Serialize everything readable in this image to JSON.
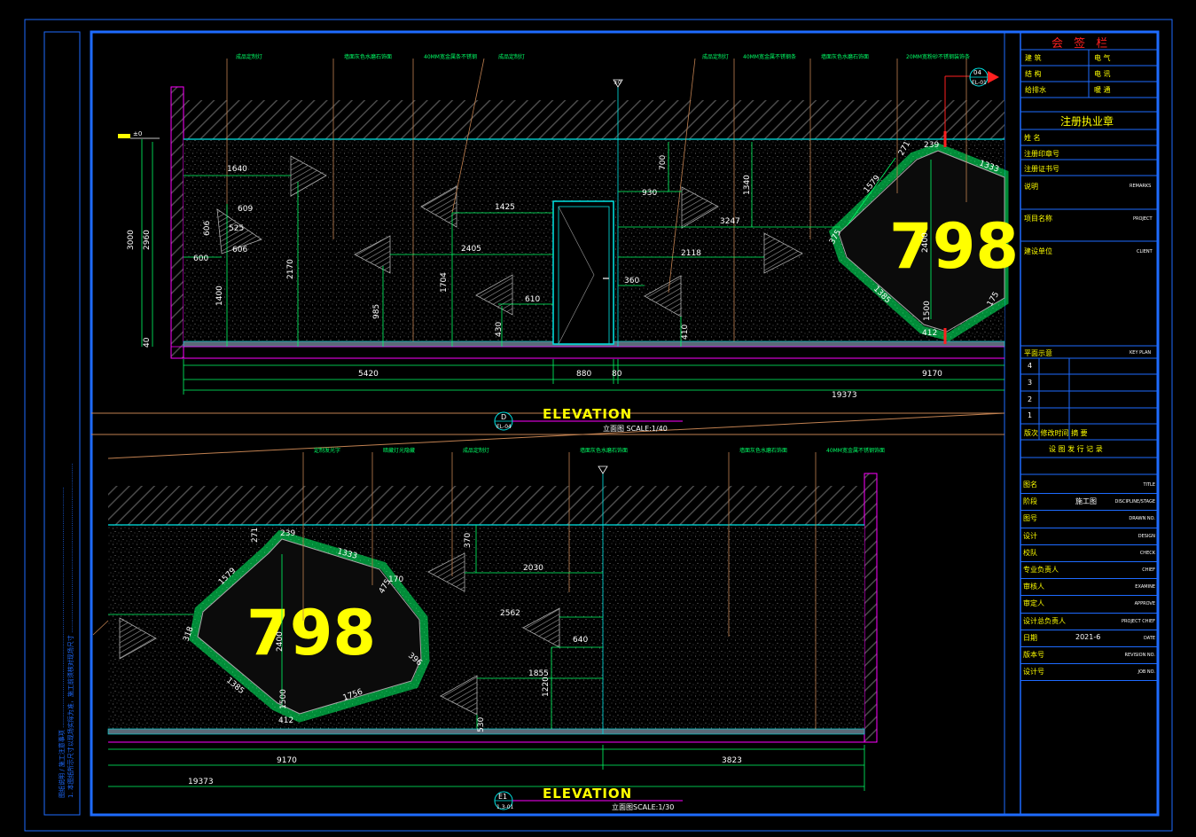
{
  "colors": {
    "frame": "#1e6bff",
    "dim": "#00ff66",
    "wall": "#ff00ff",
    "ceiling": "#00e5e5",
    "note": "#c8c800",
    "leader": "#c08050",
    "big": "#ffff00",
    "red": "#ff2020",
    "text": "#ffffff"
  },
  "top_view": {
    "big_number": "798",
    "elevation_word": "ELEVATION",
    "scale": "立面图 SCALE:1/40",
    "callout_top": "D",
    "callout_bottom": "EL-04",
    "level_mark": "±0",
    "ref_top": "04",
    "ref_bottom": "EL-01",
    "dims": {
      "d3000": "3000",
      "d2960": "2960",
      "d40": "40",
      "d1640": "1640",
      "d609": "609",
      "d525": "525",
      "d606a": "606",
      "d606b": "606",
      "d600": "600",
      "d2170": "2170",
      "d1400": "1400",
      "d985": "985",
      "d1425": "1425",
      "d2405": "2405",
      "d1704": "1704",
      "d610": "610",
      "d430": "430",
      "d700": "700",
      "d930": "930",
      "d3247": "3247",
      "d1340": "1340",
      "d2118": "2118",
      "d360": "360",
      "d410": "410",
      "d239": "239",
      "d271": "271",
      "d1333": "1333",
      "d1579": "1579",
      "d375": "375",
      "d2400": "2400",
      "d1385": "1385",
      "d1500": "1500",
      "d412": "412",
      "d175": "175",
      "d5420": "5420",
      "d880": "880",
      "d80": "80",
      "d9170": "9170",
      "d19373": "19373"
    }
  },
  "bottom_view": {
    "big_number": "798",
    "elevation_word": "ELEVATION",
    "scale": "立面图SCALE:1/30",
    "callout_top": "E1",
    "callout_bottom": "1.3-01",
    "dims": {
      "d271": "271",
      "d239": "239",
      "d1333": "1333",
      "d1579": "1579",
      "d318": "318",
      "d2400": "2400",
      "d1385": "1385",
      "d1756": "1756",
      "d1500": "1500",
      "d412": "412",
      "d170": "170",
      "d475": "475",
      "d396": "396",
      "d370": "370",
      "d2030": "2030",
      "d2562": "2562",
      "d640": "640",
      "d1855": "1855",
      "d1220": "1220",
      "d530": "530",
      "d9170": "9170",
      "d3823": "3823",
      "d19373": "19373"
    }
  },
  "title_block": {
    "sign_header": "会 签 栏",
    "sign_rows": [
      [
        "建 筑",
        "电 气"
      ],
      [
        "结 构",
        "电 讯"
      ],
      [
        "给排水",
        "暖 通"
      ]
    ],
    "seal": "注册执业章",
    "seal_rows": [
      "姓  名",
      "注册印章号",
      "注册证书号"
    ],
    "remarks": "说明",
    "remarks_en": "REMARKS",
    "project": "项目名称",
    "project_en": "PROJECT",
    "client": "建设单位",
    "client_en": "CLIENT",
    "keyplan": "平面示意",
    "keyplan_en": "KEY PLAN",
    "revisions": [
      "4",
      "3",
      "2",
      "1"
    ],
    "rev_header": "版次  修改时间       摘   要",
    "rev_record": "设 图 发 行 记 录",
    "info_rows": [
      {
        "cn": "图名",
        "val": "",
        "en": "TITLE"
      },
      {
        "cn": "阶段",
        "val": "施工图",
        "en": "DISCIPLINE/STAGE"
      },
      {
        "cn": "图号",
        "val": "",
        "en": "DRAWN NO."
      },
      {
        "cn": "设计",
        "val": "",
        "en": "DESIGN"
      },
      {
        "cn": "校队",
        "val": "",
        "en": "CHECK"
      },
      {
        "cn": "专业负责人",
        "val": "",
        "en": "CHIEF"
      },
      {
        "cn": "审核人",
        "val": "",
        "en": "EXAMINE"
      },
      {
        "cn": "审定人",
        "val": "",
        "en": "APPROVE"
      },
      {
        "cn": "设计总负责人",
        "val": "",
        "en": "PROJECT CHIEF"
      },
      {
        "cn": "日期",
        "val": "2021-6",
        "en": "DATE"
      },
      {
        "cn": "版本号",
        "val": "",
        "en": "REVISION NO."
      },
      {
        "cn": "设计号",
        "val": "",
        "en": "JOB NO."
      }
    ]
  }
}
